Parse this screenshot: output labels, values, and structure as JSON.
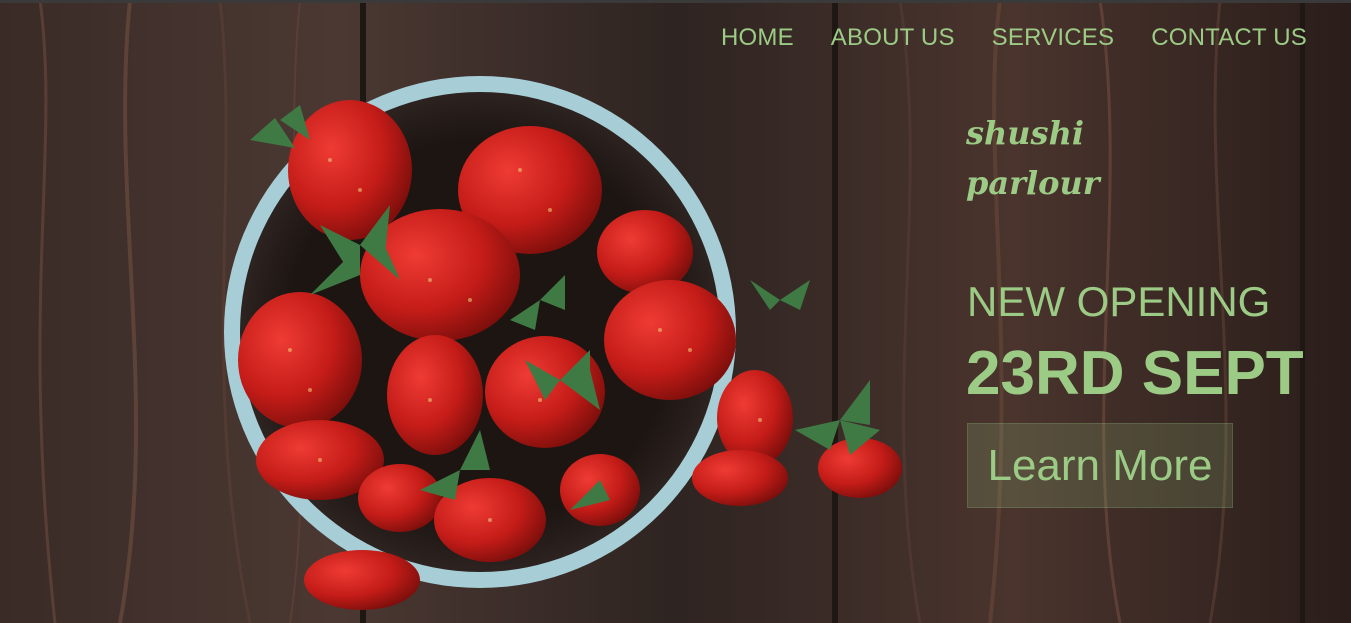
{
  "nav": {
    "items": [
      "HOME",
      "ABOUT US",
      "SERVICES",
      "CONTACT US"
    ]
  },
  "brand": {
    "line1": "shushi",
    "line2": "parlour"
  },
  "hero": {
    "announcement": "NEW OPENING",
    "date": "23RD SEPT",
    "cta_label": "Learn More"
  },
  "colors": {
    "accent": "#9ccb86",
    "wood_dark": "#2a1f1c",
    "wood_mid": "#4a3530",
    "bowl": "#a9cfd8",
    "strawberry": "#c8211c",
    "leaf": "#3f7a45"
  }
}
